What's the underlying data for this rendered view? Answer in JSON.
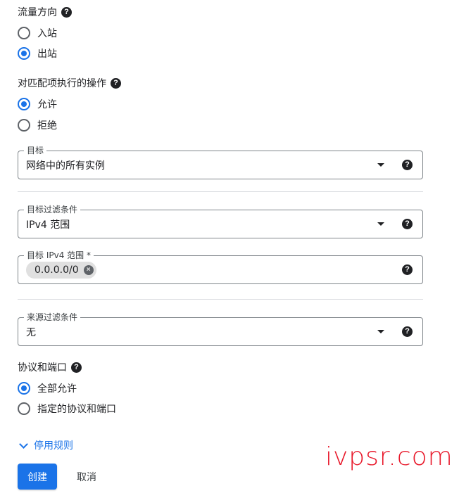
{
  "traffic_direction": {
    "label": "流量方向",
    "options": [
      {
        "label": "入站",
        "checked": false
      },
      {
        "label": "出站",
        "checked": true
      }
    ]
  },
  "action_on_match": {
    "label": "对匹配项执行的操作",
    "options": [
      {
        "label": "允许",
        "checked": true
      },
      {
        "label": "拒绝",
        "checked": false
      }
    ]
  },
  "target": {
    "legend": "目标",
    "value": "网络中的所有实例"
  },
  "target_filter": {
    "legend": "目标过滤条件",
    "value": "IPv4 范围"
  },
  "target_ipv4_ranges": {
    "legend": "目标 IPv4 范围 *",
    "chips": [
      "0.0.0.0/0"
    ]
  },
  "source_filter": {
    "legend": "来源过滤条件",
    "value": "无"
  },
  "protocols_ports": {
    "label": "协议和端口",
    "options": [
      {
        "label": "全部允许",
        "checked": true
      },
      {
        "label": "指定的协议和端口",
        "checked": false
      }
    ]
  },
  "disable_rule_label": "停用规则",
  "buttons": {
    "create": "创建",
    "cancel": "取消"
  },
  "help_glyph": "?",
  "chip_remove_glyph": "×",
  "watermark": "ivpsr.com",
  "colors": {
    "accent": "#1a73e8",
    "watermark": "#e8182a"
  }
}
